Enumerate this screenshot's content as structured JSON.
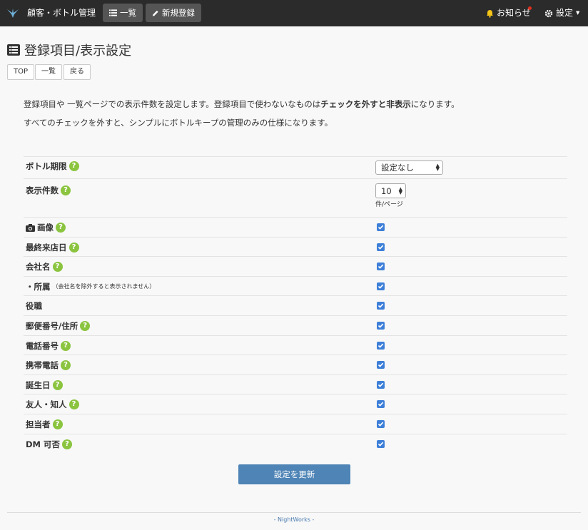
{
  "navbar": {
    "brand": "顧客・ボトル管理",
    "list_label": "一覧",
    "new_label": "新規登録",
    "notify_label": "お知らせ",
    "settings_label": "設定",
    "colors": {
      "bg": "#2b2b2b",
      "button": "#555555",
      "dot": "#e0301e"
    }
  },
  "page": {
    "title": "登録項目/表示設定",
    "buttons": [
      "TOP",
      "一覧",
      "戻る"
    ],
    "description_line1_a": "登録項目や 一覧ページでの表示件数を設定します。登録項目で使わないなものは",
    "description_line1_b": "チェックを外すと非表示",
    "description_line1_c": "になります。",
    "description_line2": "すべてのチェックを外すと、シンプルにボトルキープの管理のみの仕様になります。"
  },
  "settings": {
    "bottle_expiry_label": "ボトル期限",
    "bottle_expiry_value": "設定なし",
    "page_size_label": "表示件数",
    "page_size_value": "10",
    "page_size_unit": "件/ページ",
    "fields": [
      {
        "label": "画像",
        "icon": "camera-icon",
        "help": true,
        "checked": true
      },
      {
        "label": "最終来店日",
        "help": true,
        "checked": true
      },
      {
        "label": "会社名",
        "help": true,
        "checked": true
      },
      {
        "label": "・所属",
        "note": "（会社名を除外すると表示されません）",
        "help": false,
        "checked": true
      },
      {
        "label": "役職",
        "help": false,
        "checked": true
      },
      {
        "label": "郵便番号/住所",
        "help": true,
        "checked": true
      },
      {
        "label": "電話番号",
        "help": true,
        "checked": true
      },
      {
        "label": "携帯電話",
        "help": true,
        "checked": true
      },
      {
        "label": "誕生日",
        "help": true,
        "checked": true
      },
      {
        "label": "友人・知人",
        "help": true,
        "checked": true
      },
      {
        "label": "担当者",
        "help": true,
        "checked": true
      },
      {
        "label": "DM 可否",
        "help": true,
        "checked": true
      }
    ],
    "help_glyph": "?",
    "submit_label": "設定を更新",
    "colors": {
      "help": "#8bc43f",
      "check": "#3d7fd8",
      "submit": "#4f84b6"
    }
  },
  "footer": {
    "text": "- NightWorks -"
  }
}
